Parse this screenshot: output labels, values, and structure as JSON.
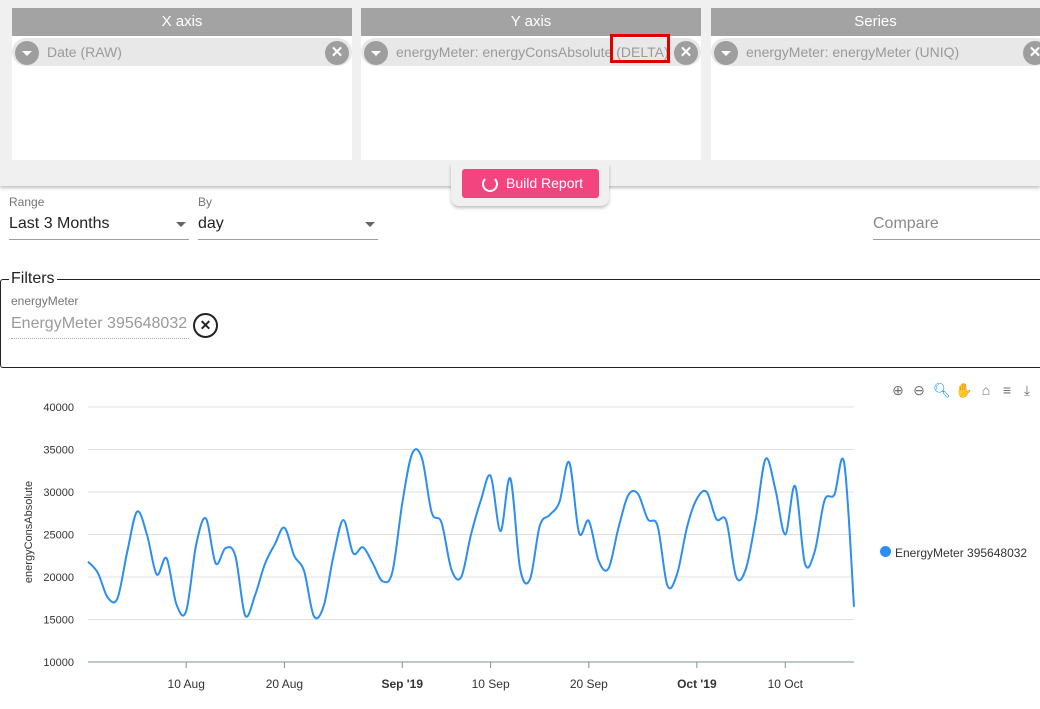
{
  "report_builder": {
    "x_axis": {
      "header": "X axis",
      "chip": "Date (RAW)"
    },
    "y_axis": {
      "header": "Y axis",
      "chip": "energyMeter: energyConsAbsolute (DELTA)"
    },
    "series": {
      "header": "Series",
      "chip": "energyMeter: energyMeter (UNIQ)"
    },
    "build_label": "Build Report"
  },
  "controls": {
    "range_label": "Range",
    "range_value": "Last 3 Months",
    "by_label": "By",
    "by_value": "day",
    "compare_placeholder": "Compare"
  },
  "filters": {
    "title": "Filters",
    "field_label": "energyMeter",
    "field_value": "EnergyMeter 395648032"
  },
  "colors": {
    "accent": "#f2457f",
    "series": "#2b8ef0",
    "highlight": "#e00000"
  },
  "chart_data": {
    "type": "line",
    "ylabel": "energyConsAbsolute",
    "ylim": [
      10000,
      40000
    ],
    "y_ticks": [
      10000,
      15000,
      20000,
      25000,
      30000,
      35000,
      40000
    ],
    "x_tick_labels": [
      "10 Aug",
      "20 Aug",
      "Sep '19",
      "10 Sep",
      "20 Sep",
      "Oct '19",
      "10 Oct"
    ],
    "x_tick_bold": [
      false,
      false,
      true,
      false,
      false,
      true,
      false
    ],
    "x": [
      "2019-07-31",
      "2019-08-01",
      "2019-08-02",
      "2019-08-03",
      "2019-08-04",
      "2019-08-05",
      "2019-08-06",
      "2019-08-07",
      "2019-08-08",
      "2019-08-09",
      "2019-08-10",
      "2019-08-11",
      "2019-08-12",
      "2019-08-13",
      "2019-08-14",
      "2019-08-15",
      "2019-08-16",
      "2019-08-17",
      "2019-08-18",
      "2019-08-19",
      "2019-08-20",
      "2019-08-21",
      "2019-08-22",
      "2019-08-23",
      "2019-08-24",
      "2019-08-25",
      "2019-08-26",
      "2019-08-27",
      "2019-08-28",
      "2019-08-29",
      "2019-08-30",
      "2019-08-31",
      "2019-09-01",
      "2019-09-02",
      "2019-09-03",
      "2019-09-04",
      "2019-09-05",
      "2019-09-06",
      "2019-09-07",
      "2019-09-08",
      "2019-09-09",
      "2019-09-10",
      "2019-09-11",
      "2019-09-12",
      "2019-09-13",
      "2019-09-14",
      "2019-09-15",
      "2019-09-16",
      "2019-09-17",
      "2019-09-18",
      "2019-09-19",
      "2019-09-20",
      "2019-09-21",
      "2019-09-22",
      "2019-09-23",
      "2019-09-24",
      "2019-09-25",
      "2019-09-26",
      "2019-09-27",
      "2019-09-28",
      "2019-09-29",
      "2019-09-30",
      "2019-10-01",
      "2019-10-02",
      "2019-10-03",
      "2019-10-04",
      "2019-10-05",
      "2019-10-06",
      "2019-10-07",
      "2019-10-08",
      "2019-10-09",
      "2019-10-10",
      "2019-10-11",
      "2019-10-12",
      "2019-10-13",
      "2019-10-14",
      "2019-10-15",
      "2019-10-16",
      "2019-10-17"
    ],
    "series": [
      {
        "name": "EnergyMeter 395648032",
        "values": [
          21800,
          20500,
          17600,
          17500,
          23000,
          27700,
          25000,
          20300,
          22200,
          16800,
          16000,
          23700,
          26900,
          21600,
          23400,
          22500,
          15500,
          17800,
          21500,
          23800,
          25800,
          22500,
          20700,
          15400,
          16600,
          22500,
          26700,
          22800,
          23500,
          21600,
          19500,
          20600,
          28700,
          34500,
          34000,
          27600,
          26400,
          20900,
          20000,
          25000,
          29000,
          31900,
          25400,
          31600,
          21000,
          19700,
          26000,
          27300,
          28800,
          33500,
          25200,
          26600,
          21900,
          21000,
          25700,
          29600,
          29800,
          26800,
          26000,
          19000,
          20400,
          25900,
          29200,
          30000,
          26800,
          26600,
          20000,
          21000,
          26800,
          33900,
          30300,
          25000,
          30700,
          21600,
          23000,
          29000,
          29700,
          33400,
          16500
        ]
      }
    ]
  }
}
